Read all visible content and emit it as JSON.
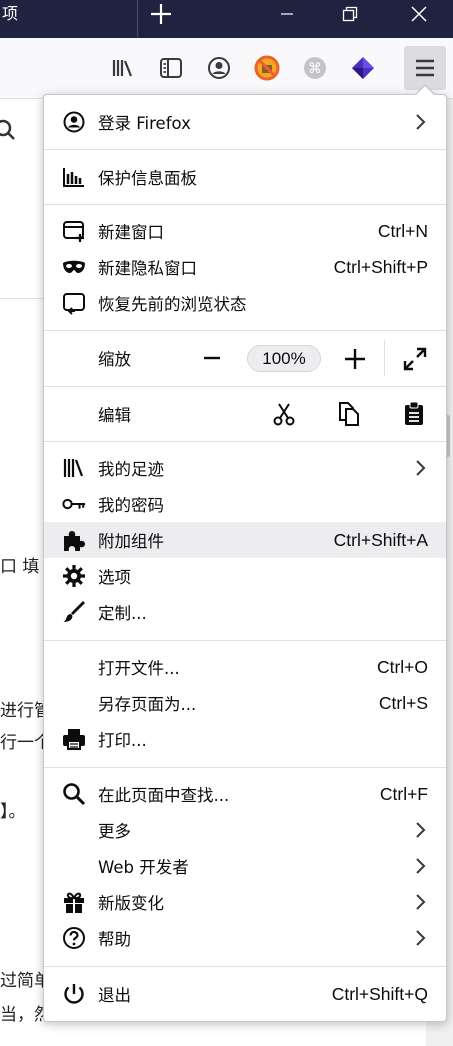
{
  "window": {
    "tab_fragment": "项",
    "new_tab_glyph": "+"
  },
  "toolbar": {
    "icons": [
      "library-icon",
      "sidebar-icon",
      "account-icon",
      "extension-blocker-icon",
      "extension-cmd-icon",
      "extension-cube-icon",
      "hamburger-menu-icon"
    ]
  },
  "background_text": {
    "line1": "口 填",
    "line2": "进行管",
    "line3": "行一个",
    "line4": "】。",
    "line5": "过简单",
    "line6": "当，然"
  },
  "menu": {
    "sign_in": "登录 Firefox",
    "protections": "保护信息面板",
    "new_window": {
      "label": "新建窗口",
      "shortcut": "Ctrl+N"
    },
    "private_window": {
      "label": "新建隐私窗口",
      "shortcut": "Ctrl+Shift+P"
    },
    "restore_session": "恢复先前的浏览状态",
    "zoom": {
      "label": "缩放",
      "value": "100%"
    },
    "edit": {
      "label": "编辑"
    },
    "library": "我的足迹",
    "passwords": "我的密码",
    "addons": {
      "label": "附加组件",
      "shortcut": "Ctrl+Shift+A"
    },
    "options": "选项",
    "customize": "定制...",
    "open_file": {
      "label": "打开文件...",
      "shortcut": "Ctrl+O"
    },
    "save_page": {
      "label": "另存页面为...",
      "shortcut": "Ctrl+S"
    },
    "print": "打印...",
    "find": {
      "label": "在此页面中查找...",
      "shortcut": "Ctrl+F"
    },
    "more": "更多",
    "web_developer": "Web 开发者",
    "whats_new": "新版变化",
    "help": "帮助",
    "quit": {
      "label": "退出",
      "shortcut": "Ctrl+Shift+Q"
    }
  },
  "colors": {
    "titlebar": "#202340",
    "hover_row": "#ededf0",
    "extension_red": "#e8632e",
    "extension_purple": "#4b2dbf"
  }
}
